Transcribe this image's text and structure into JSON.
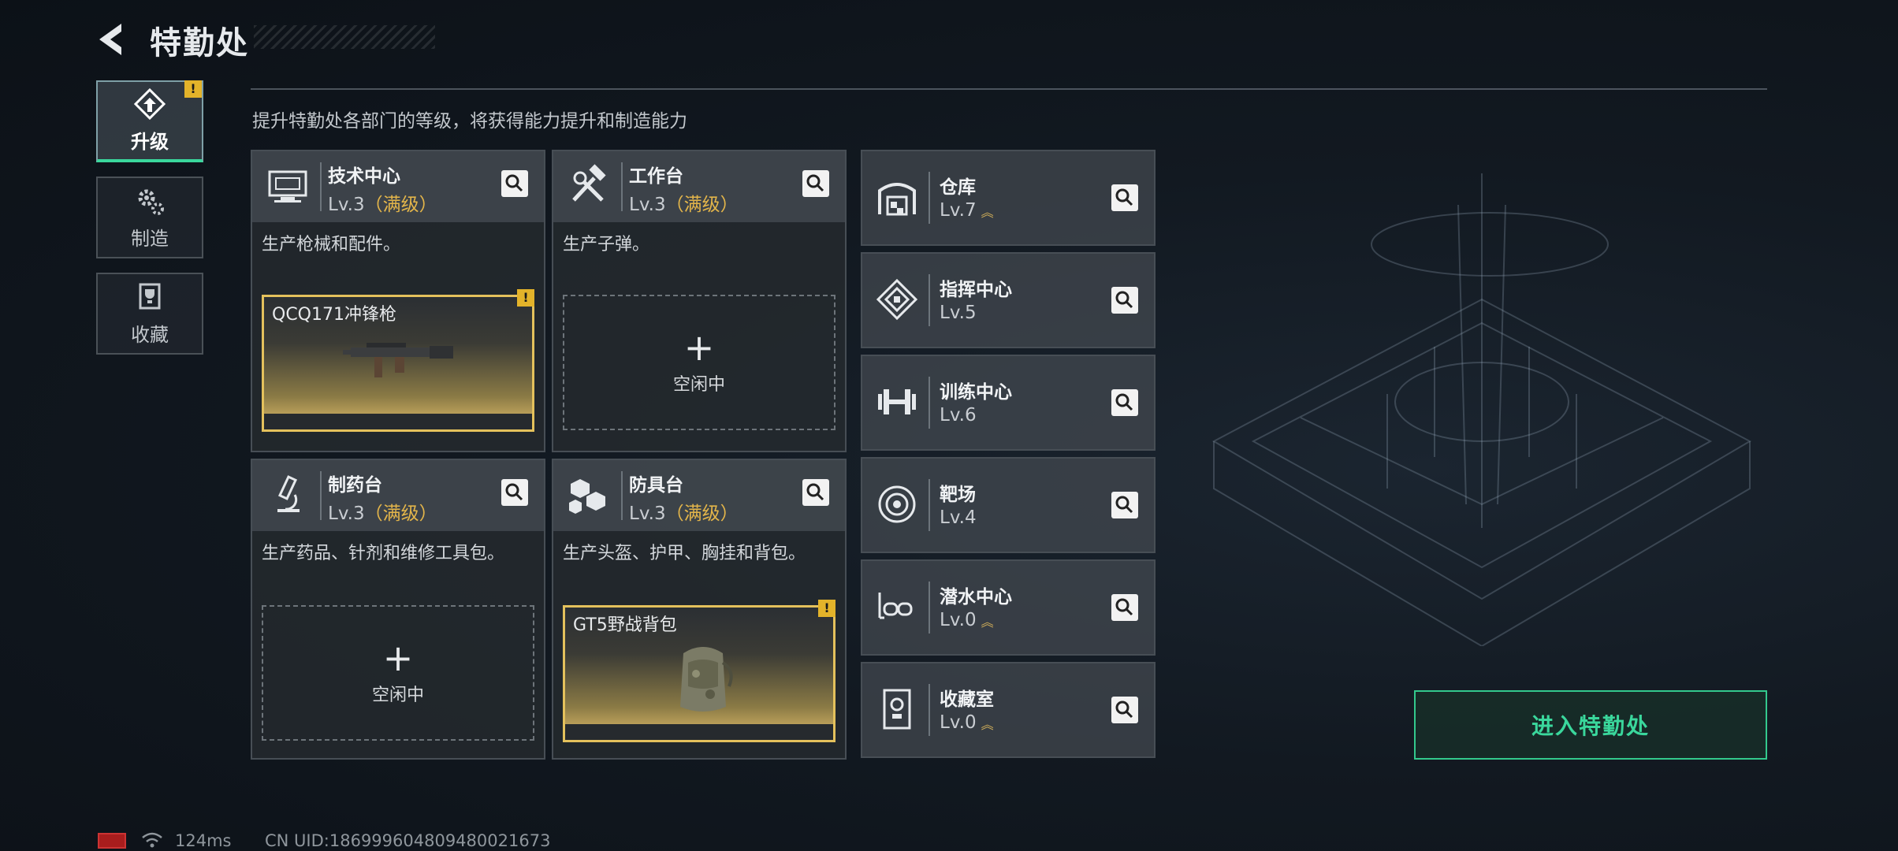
{
  "header": {
    "title": "特勤处"
  },
  "tabs": [
    {
      "label": "升级",
      "active": true,
      "warn": "!"
    },
    {
      "label": "制造",
      "active": false
    },
    {
      "label": "收藏",
      "active": false
    }
  ],
  "subtitle": "提升特勤处各部门的等级，将获得能力提升和制造能力",
  "facilities": [
    {
      "name": "技术中心",
      "level": "Lv.3",
      "max": "（满级）",
      "desc": "生产枪械和配件。",
      "slot": {
        "type": "item",
        "name": "QCQ171冲锋枪",
        "warn": "!"
      }
    },
    {
      "name": "工作台",
      "level": "Lv.3",
      "max": "（满级）",
      "desc": "生产子弹。",
      "slot": {
        "type": "empty",
        "plus": "+",
        "idle": "空闲中"
      }
    },
    {
      "name": "制药台",
      "level": "Lv.3",
      "max": "（满级）",
      "desc": "生产药品、针剂和维修工具包。",
      "slot": {
        "type": "empty",
        "plus": "+",
        "idle": "空闲中"
      }
    },
    {
      "name": "防具台",
      "level": "Lv.3",
      "max": "（满级）",
      "desc": "生产头盔、护甲、胸挂和背包。",
      "slot": {
        "type": "item",
        "name": "GT5野战背包",
        "warn": "!"
      }
    }
  ],
  "buildings": [
    {
      "name": "仓库",
      "level": "Lv.7",
      "upgradable": true
    },
    {
      "name": "指挥中心",
      "level": "Lv.5",
      "upgradable": false
    },
    {
      "name": "训练中心",
      "level": "Lv.6",
      "upgradable": false
    },
    {
      "name": "靶场",
      "level": "Lv.4",
      "upgradable": false
    },
    {
      "name": "潜水中心",
      "level": "Lv.0",
      "upgradable": true
    },
    {
      "name": "收藏室",
      "level": "Lv.0",
      "upgradable": true
    }
  ],
  "enter_button": "进入特勤处",
  "status": {
    "ping": "124ms",
    "uid": "CN UID:1869996048094800216​73"
  },
  "colors": {
    "accent": "#3ad79c",
    "gold": "#e3b54a",
    "warn": "#e3b32a"
  }
}
